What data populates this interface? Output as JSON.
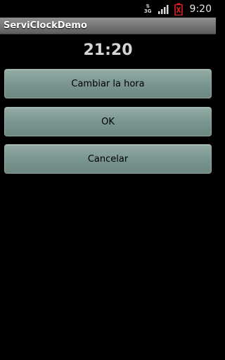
{
  "status_bar": {
    "network_label_top": "⇅",
    "network_label_bottom": "3G",
    "time": "9:20",
    "icons": [
      "network-3g-icon",
      "signal-strength-icon",
      "battery-alert-icon"
    ],
    "battery_color": "#e02020"
  },
  "app": {
    "title": "ServiClockDemo"
  },
  "main": {
    "time_display": "21:20",
    "buttons": [
      {
        "label": "Cambiar la hora"
      },
      {
        "label": "OK"
      },
      {
        "label": "Cancelar"
      }
    ]
  }
}
